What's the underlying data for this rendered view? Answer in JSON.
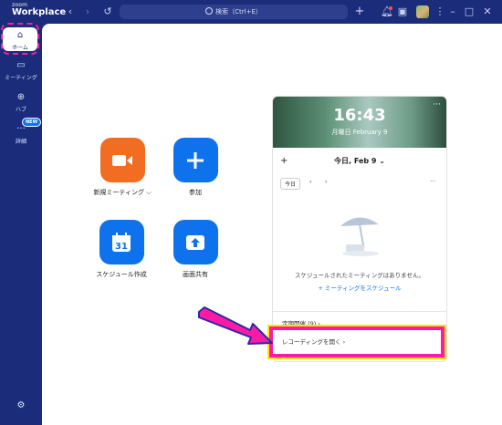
{
  "app": {
    "logo_small": "zoom",
    "logo_large": "Workplace"
  },
  "header": {
    "search_placeholder": "検索（Ctrl+E）"
  },
  "sidebar": {
    "home": "ホーム",
    "meetings": "ミーティング",
    "hub": "ハブ",
    "details": "詳細",
    "new_badge": "NEW"
  },
  "actions": [
    {
      "label": "新規ミーティング ⌵",
      "color": "#f26d21"
    },
    {
      "label": "参加",
      "color": "#0e72ed"
    },
    {
      "label": "スケジュール作成",
      "color": "#0e72ed",
      "day": "31"
    },
    {
      "label": "画面共有",
      "color": "#0e72ed"
    }
  ],
  "panel": {
    "time": "16:43",
    "date": "月曜日  February 9",
    "date_nav": "今日, Feb 9 ⌄",
    "today_button": "今日",
    "empty_message": "スケジュールされたミーティングはありません。",
    "schedule_link": "+ ミーティングをスケジュール",
    "recurring": "定期開催 (9) ›",
    "open_recordings": "レコーディングを開く ›"
  },
  "colors": {
    "brand": "#1a2c7a",
    "accent": "#0e72ed",
    "orange": "#f26d21",
    "highlight": "#ff1aa5"
  }
}
